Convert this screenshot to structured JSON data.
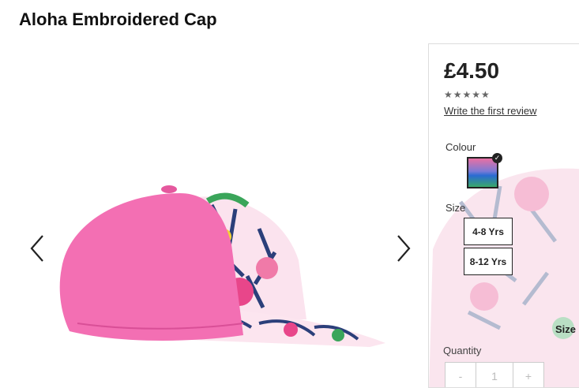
{
  "product": {
    "title": "Aloha Embroidered Cap",
    "price": "£4.50",
    "stars": "★★★★★",
    "review_link": "Write the first review"
  },
  "options": {
    "colour_label": "Colour",
    "colour_check": "✓",
    "size_label": "Size",
    "sizes": [
      "4-8 Yrs",
      "8-12 Yrs"
    ],
    "size_guide": "Size"
  },
  "quantity": {
    "label": "Quantity",
    "minus": "-",
    "value": "1",
    "plus": "+"
  },
  "colors": {
    "cap_pink": "#f36fb3",
    "text": "#222222"
  }
}
